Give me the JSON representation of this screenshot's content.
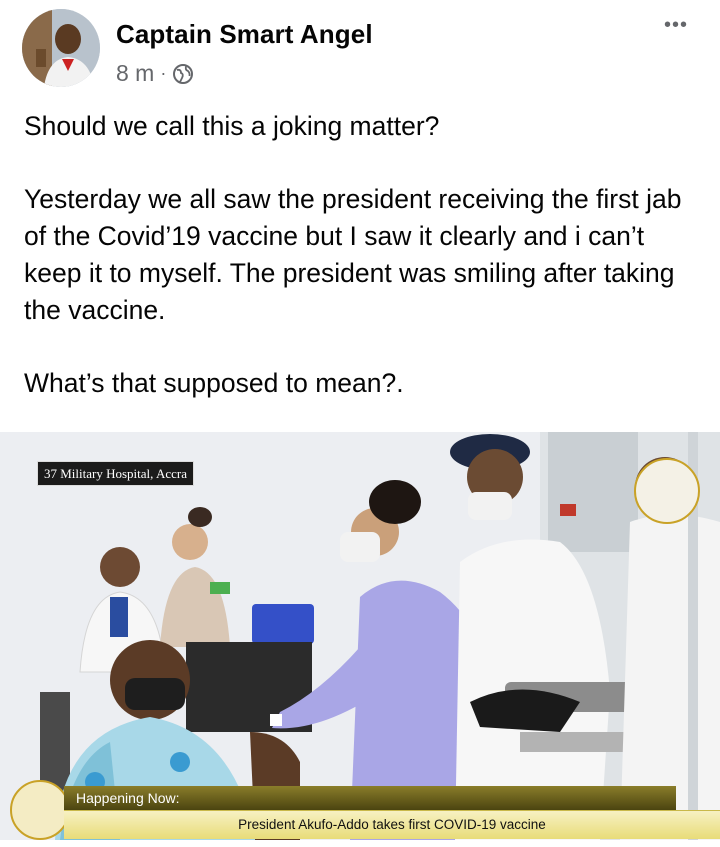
{
  "post": {
    "author": "Captain Smart Angel",
    "time": "8 m",
    "separator": "·",
    "privacy_icon": "globe-icon",
    "more_icon": "more-horizontal-icon",
    "more_label": "•••",
    "text": [
      "Should we call this a joking matter?",
      "Yesterday we all saw the president receiving the first jab of the Covid’19 vaccine but I saw it clearly and i can’t keep it to myself. The president was smiling after taking the vaccine.",
      "What’s that supposed to mean?."
    ]
  },
  "photo": {
    "location_tag": "37 Military Hospital, Accra",
    "ticker_label": "Happening Now:",
    "ticker_text": "President Akufo-Addo takes first COVID-19 vaccine"
  },
  "colors": {
    "meta_text": "#65676b",
    "ticker_dark": "#6a5e1c",
    "ticker_light": "#efe59a",
    "scrubs": "#a9a6e6"
  }
}
